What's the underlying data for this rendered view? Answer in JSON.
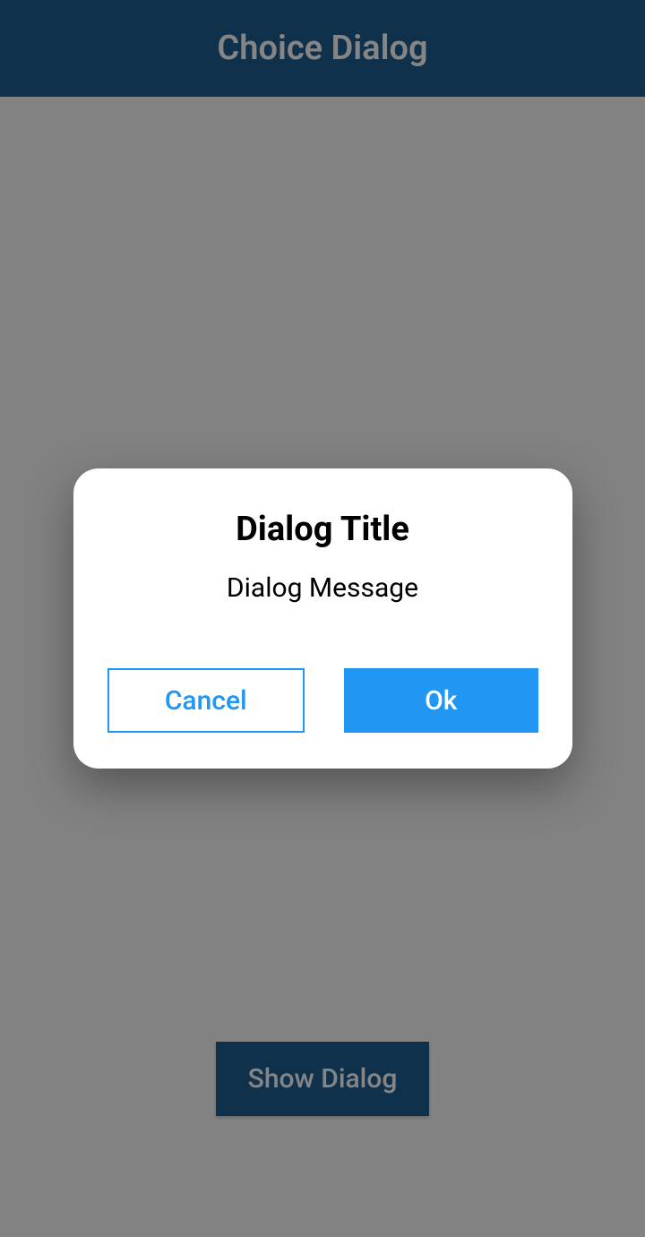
{
  "header": {
    "title": "Choice Dialog"
  },
  "main": {
    "show_button_label": "Show Dialog"
  },
  "dialog": {
    "title": "Dialog Title",
    "message": "Dialog Message",
    "cancel_label": "Cancel",
    "ok_label": "Ok"
  },
  "colors": {
    "primary": "#1f5f93",
    "accent": "#2196f3"
  }
}
